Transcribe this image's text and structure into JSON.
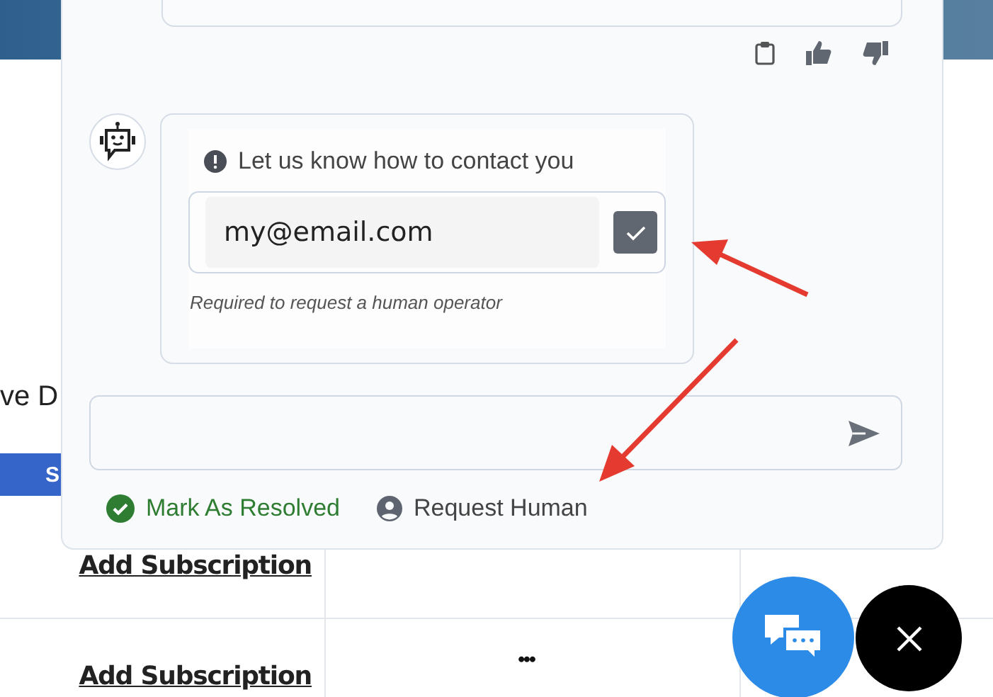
{
  "page": {
    "heading_fragment": "ve D",
    "button_label": "S",
    "rows": [
      {
        "link": "Add Subscription"
      },
      {
        "link": "Add Subscription",
        "menu": "•••"
      }
    ]
  },
  "chat": {
    "contact_form": {
      "title": "Let us know how to contact you",
      "email_value": "my@email.com",
      "hint": "Required to request a human operator"
    },
    "footer_actions": [
      {
        "kind": "resolve",
        "label": "Mark As Resolved"
      },
      {
        "kind": "human",
        "label": "Request Human"
      }
    ]
  }
}
